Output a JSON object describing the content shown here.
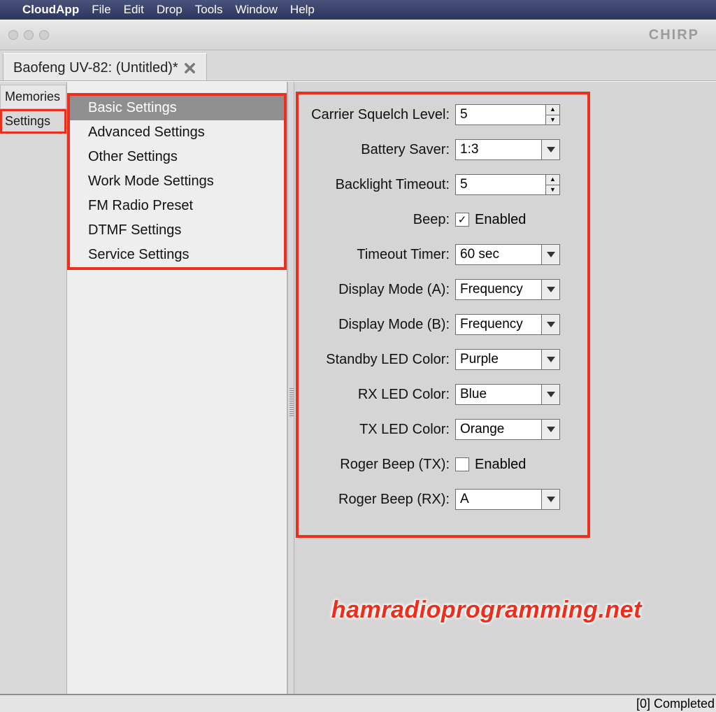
{
  "menubar": {
    "app": "CloudApp",
    "items": [
      "File",
      "Edit",
      "Drop",
      "Tools",
      "Window",
      "Help"
    ]
  },
  "window": {
    "title": "CHIRP"
  },
  "doctab": {
    "label": "Baofeng UV-82: (Untitled)*"
  },
  "left_tabs": [
    "Memories",
    "Settings"
  ],
  "categories": [
    "Basic Settings",
    "Advanced Settings",
    "Other Settings",
    "Work Mode Settings",
    "FM Radio Preset",
    "DTMF Settings",
    "Service Settings"
  ],
  "form": {
    "rows": [
      {
        "label": "Carrier Squelch Level:",
        "type": "spinner",
        "value": "5"
      },
      {
        "label": "Battery Saver:",
        "type": "select",
        "value": "1:3"
      },
      {
        "label": "Backlight Timeout:",
        "type": "spinner",
        "value": "5"
      },
      {
        "label": "Beep:",
        "type": "check",
        "checked": true,
        "text": "Enabled"
      },
      {
        "label": "Timeout Timer:",
        "type": "select",
        "value": "60 sec"
      },
      {
        "label": "Display Mode (A):",
        "type": "select",
        "value": "Frequency"
      },
      {
        "label": "Display Mode (B):",
        "type": "select",
        "value": "Frequency"
      },
      {
        "label": "Standby LED Color:",
        "type": "select",
        "value": "Purple"
      },
      {
        "label": "RX LED Color:",
        "type": "select",
        "value": "Blue"
      },
      {
        "label": "TX LED Color:",
        "type": "select",
        "value": "Orange"
      },
      {
        "label": "Roger Beep (TX):",
        "type": "check",
        "checked": false,
        "text": "Enabled"
      },
      {
        "label": "Roger Beep (RX):",
        "type": "select",
        "value": "A"
      }
    ]
  },
  "watermark": "hamradioprogramming.net",
  "status": "[0] Completed"
}
